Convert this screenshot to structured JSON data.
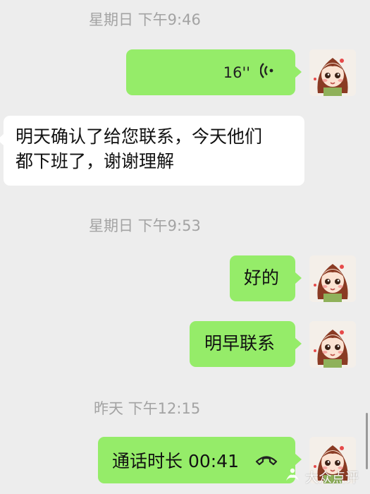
{
  "timestamps": [
    "星期日 下午9:46",
    "星期日 下午9:53",
    "昨天 下午12:15"
  ],
  "messages": {
    "voice_duration": "16''",
    "incoming_line1": "明天确认了给您联系，今天他们",
    "incoming_line2": "都下班了，谢谢理解",
    "reply_ok": "好的",
    "reply_contact": "明早联系",
    "call_label": "通话时长 00:41"
  },
  "watermark": "大众点评",
  "colors": {
    "background": "#ededed",
    "sent_bubble": "#95ec69",
    "received_bubble": "#ffffff",
    "timestamp": "#a3a3a3"
  },
  "icons": [
    "voice-wave-icon",
    "phone-hangup-icon",
    "avatar-girl-image",
    "watermark-logo-icon"
  ]
}
